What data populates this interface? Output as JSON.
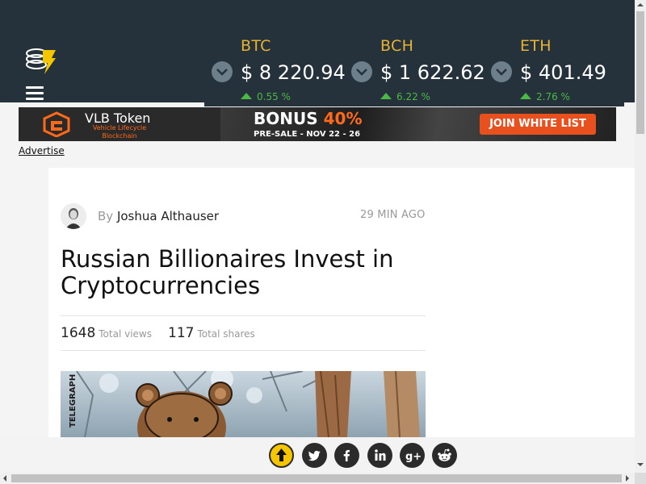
{
  "header": {
    "tickers": [
      {
        "symbol": "BTC",
        "price": "$ 8 220.94",
        "change": "0.55 %"
      },
      {
        "symbol": "BCH",
        "price": "$ 1 622.62",
        "change": "6.22 %"
      },
      {
        "symbol": "ETH",
        "price": "$ 401.49",
        "change": "2.76 %"
      }
    ]
  },
  "banner": {
    "brand": "VLB Token",
    "tagline": "Vehicle Lifecycle Blockchain",
    "bonus_label": "BONUS",
    "bonus_pct": "40%",
    "presale": "PRE-SALE  - NOV 22 - 26",
    "cta": "JOIN WHITE LIST"
  },
  "advertise_link": "Advertise",
  "article": {
    "by": "By",
    "author": "Joshua Althauser",
    "time": "29 MIN AGO",
    "title": "Russian Billionaires Invest in Cryptocurrencies",
    "views": "1648",
    "views_label": "Total views",
    "shares": "117",
    "shares_label": "Total shares",
    "image_watermark": "TELEGRAPH"
  },
  "share_buttons": [
    "scroll-top",
    "twitter",
    "facebook",
    "linkedin",
    "google-plus",
    "reddit"
  ],
  "colors": {
    "header_bg": "#25313b",
    "ticker_symbol": "#e8b332",
    "positive_change": "#4cb944",
    "cta_orange": "#e8511d"
  }
}
